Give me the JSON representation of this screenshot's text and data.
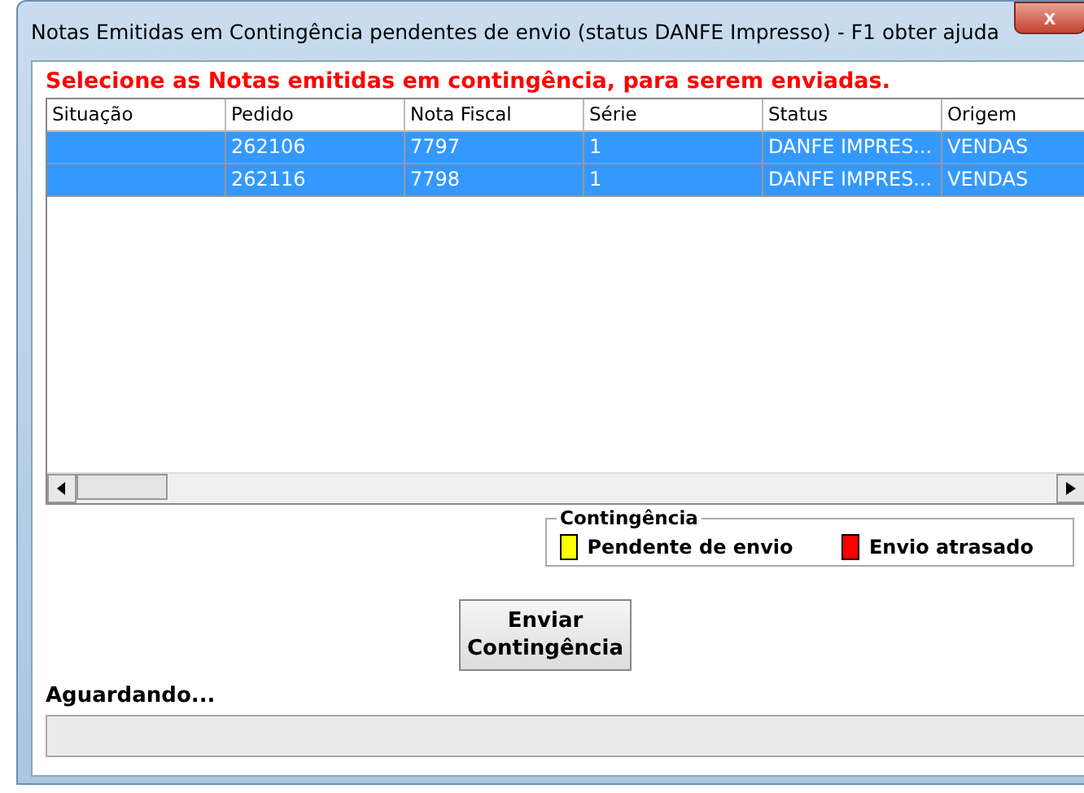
{
  "window": {
    "title": "Notas Emitidas em Contingência pendentes de envio (status DANFE Impresso) - F1 obter ajuda",
    "close": "x"
  },
  "instruction": "Selecione as Notas emitidas em contingência, para serem enviadas.",
  "table": {
    "columns": [
      "Situação",
      "Pedido",
      "Nota Fiscal",
      "Série",
      "Status",
      "Origem"
    ],
    "rows": [
      {
        "cells": [
          "",
          "262106",
          "7797",
          "1",
          "DANFE IMPRES...",
          "VENDAS"
        ],
        "selected": true
      },
      {
        "cells": [
          "",
          "262116",
          "7798",
          "1",
          "DANFE IMPRES...",
          "VENDAS"
        ],
        "selected": true
      }
    ]
  },
  "legend": {
    "title": "Contingência",
    "items": [
      {
        "label": "Pendente de envio",
        "color": "#ffff00"
      },
      {
        "label": "Envio atrasado",
        "color": "#ff0000"
      }
    ]
  },
  "send_button": "Enviar Contingência",
  "status_label": "Aguardando...",
  "progress": {
    "level": 0
  }
}
